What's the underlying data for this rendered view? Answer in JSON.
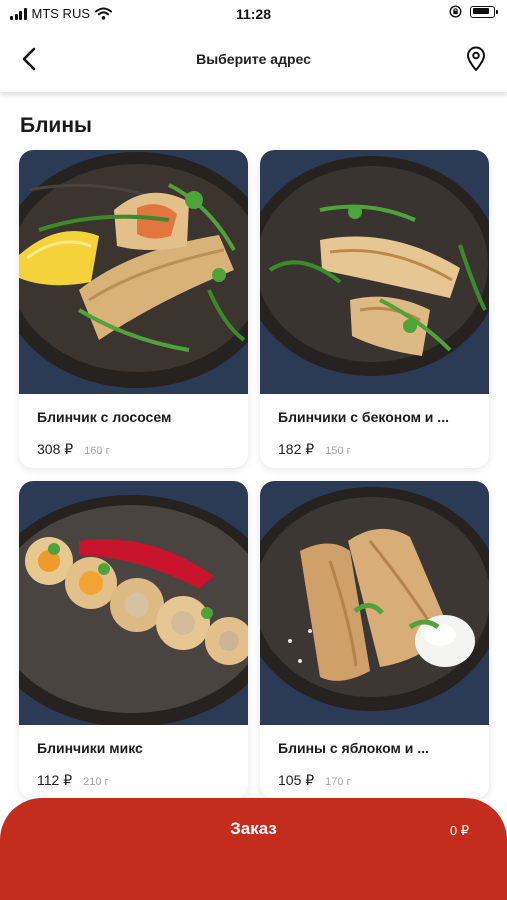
{
  "status_bar": {
    "carrier": "MTS RUS",
    "time": "11:28"
  },
  "header": {
    "back_icon": "chevron-left-icon",
    "title": "Выберите адрес",
    "location_icon": "location-pin-icon"
  },
  "section": {
    "title": "Блины"
  },
  "items": [
    {
      "name": "Блинчик с лососем",
      "price": "308 ₽",
      "weight": "160 г"
    },
    {
      "name": "Блинчики с беконом и ...",
      "price": "182 ₽",
      "weight": "150 г"
    },
    {
      "name": "Блинчики микс",
      "price": "112 ₽",
      "weight": "210 г"
    },
    {
      "name": "Блины с яблоком и ...",
      "price": "105 ₽",
      "weight": "170 г"
    }
  ],
  "order": {
    "label": "Заказ",
    "total": "0 ₽"
  },
  "colors": {
    "accent": "#c42d1d",
    "photo_background": "#2b3a55",
    "plate": "#36302c"
  }
}
